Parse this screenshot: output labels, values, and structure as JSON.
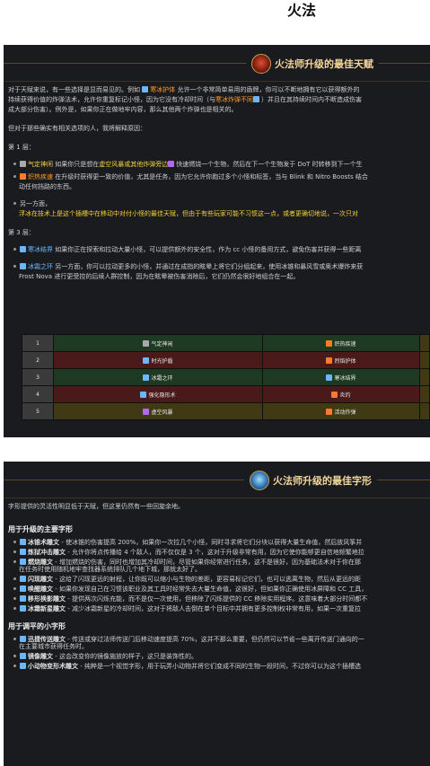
{
  "page": {
    "title": "火法"
  },
  "panel1": {
    "title": "火法师升级的最佳天赋",
    "intro_1a": "对于天赋来说，有一些选择是显而易见的。例如",
    "intro_1_talent": "寒冰护体",
    "intro_1b": "允许一个非常简单易用的盾牌，你可以不断地拥有它以获得额外的",
    "intro_2a": "持续获得价值的炸弹法术，允许你重复标记小怪，因为它没有冷却时间（与",
    "intro_2_talent": "寒冰炸弹不同",
    "intro_2b": "）并且在其持续时间内不断造成伤害",
    "intro_3": "成大部分伤害）。例外是，如果你正在做地牢内容，那么其他两个炸弹也是相关的。",
    "intro_4": "但对于那些确实有相关选项的人，我将解释原因：",
    "tier1_label": "第 1 层：",
    "t1_b1_name": "气定神闲",
    "t1_b1_a": "如果你只是想在",
    "t1_b1_hl": "虚空风暴或其他炸弹旁边",
    "t1_b1_b": "快速燃烧一个生物，然后在下一个生物发于 DoT 时转移到下一个生",
    "t1_b2_name": "炽热疾速",
    "t1_b2_a": "在升级时获得更一致的价值，尤其是任务，因为它允许你跑过多个小怪和标签，当与 Blink 和 Nitro Boosts 结合",
    "t1_b2_b": "动任何挡路的东西。",
    "t1_b3_a": "另一方面，",
    "t1_b3_hl": "浮冰在技术上是这个插槽中在移动中对付小怪的最佳天赋，但由于有些玩家可能不习惯这一点，或者更确切地说，一次只对",
    "tier3_label": "第 3 层：",
    "t3_b1_name": "寒冰结界",
    "t3_b1_a": "如果你正在探索和拉动大量小怪，可以提供额外的安全性，作为 cc 小怪的备用方式，避免伤害并获得一些距离",
    "t3_b2_name": "冰霜之环",
    "t3_b2_a": "另一方面，你可以拉动更多的小怪，并通过在成指的眩晕上将它们分组起来，使用冰锥和暴风雪或奥术爆炸来获",
    "t3_b2_b": "Frost Nova 进行更受控的后续人群控制，因为在眩晕被伤害消除后，它们仍然会很好地组合在一起。",
    "table": [
      {
        "num": "1",
        "left": "气定神闲",
        "right": "炽热疾速"
      },
      {
        "num": "2",
        "left": "时光护盾",
        "right": "烈焰护体"
      },
      {
        "num": "3",
        "left": "冰霜之环",
        "right": "寒冰结界"
      },
      {
        "num": "4",
        "left": "强化隐形术",
        "right": "炎灼"
      },
      {
        "num": "5",
        "left": "虚空风暴",
        "right": "活动炸弹"
      }
    ]
  },
  "panel2": {
    "title": "火法师升级的最佳字形",
    "intro": "字形提供的灵活性明显低于天赋，但这里仍然有一些回旋余地。",
    "major_heading": "用于升级的主要字形",
    "major": [
      {
        "name": "冰锥术雕文",
        "desc": "- 使冰锥的伤害提高 200%，如果你一次拉几个小怪，同时寻求将它们分块以获得大量生命值，然后放风筝并"
      },
      {
        "name": "炼狱冲击雕文",
        "desc": "- 允许你将点传播给 4 个敌人，而不仅仅是 3 个，这对于升级非常有用，因为它使你能够更自信地频繁地拉"
      },
      {
        "name": "燃烧雕文",
        "desc": "- 增加燃烧的伤害，同时也增加其冷却时间，尽管如果你经常进行任务，这不是很好，因为基础法术对于你在那",
        "desc2": "在任务时使用随机地牢查找器系统排队几个地下城，那就太好了。"
      },
      {
        "name": "闪现雕文",
        "desc": "- 这给了闪现更远的射程，让你既可以缩小与生物的差距，更容易标记它们，也可以逃离生物，然后从更远的距"
      },
      {
        "name": "唤醒雕文",
        "desc": "- 如果你发现自己在习惯该职业及其工具时经常失去大量生命值，这很好，但如果你正确使用冰屏障和 CC 工具，"
      },
      {
        "name": "移形换影雕文",
        "desc": "- 提供两次闪烁充能，而不是仅一次使用，但移除了闪烁提供的 CC 移除实用程序。这意味着大部分时间都不"
      },
      {
        "name": "冰霜新星雕文",
        "desc": "- 减少冰霜新星的冷却时间，这对于将敌人击倒在单个目标中并拥有更多控制权非常有用，如果一次重复拉"
      }
    ],
    "minor_heading": "用于调平的小字形",
    "minor": [
      {
        "name": "迅捷传送雕文",
        "desc": "- 传送或穿过法师传送门后移动速度提高 70%，这并不那么重要，但仍然可以节省一些离开传送门通向的一",
        "desc2": "在主要城市获得任务时。"
      },
      {
        "name": "镜像雕文",
        "desc": "- 这会改变你的镜像施放的样子，这只是装饰性的。"
      },
      {
        "name": "小动物变形术雕文",
        "desc": "- 纯粹是一个视觉字形，用于玩弄小动物并将它们变成不同的生物一段时间，不过你可以为这个插槽选"
      }
    ]
  }
}
